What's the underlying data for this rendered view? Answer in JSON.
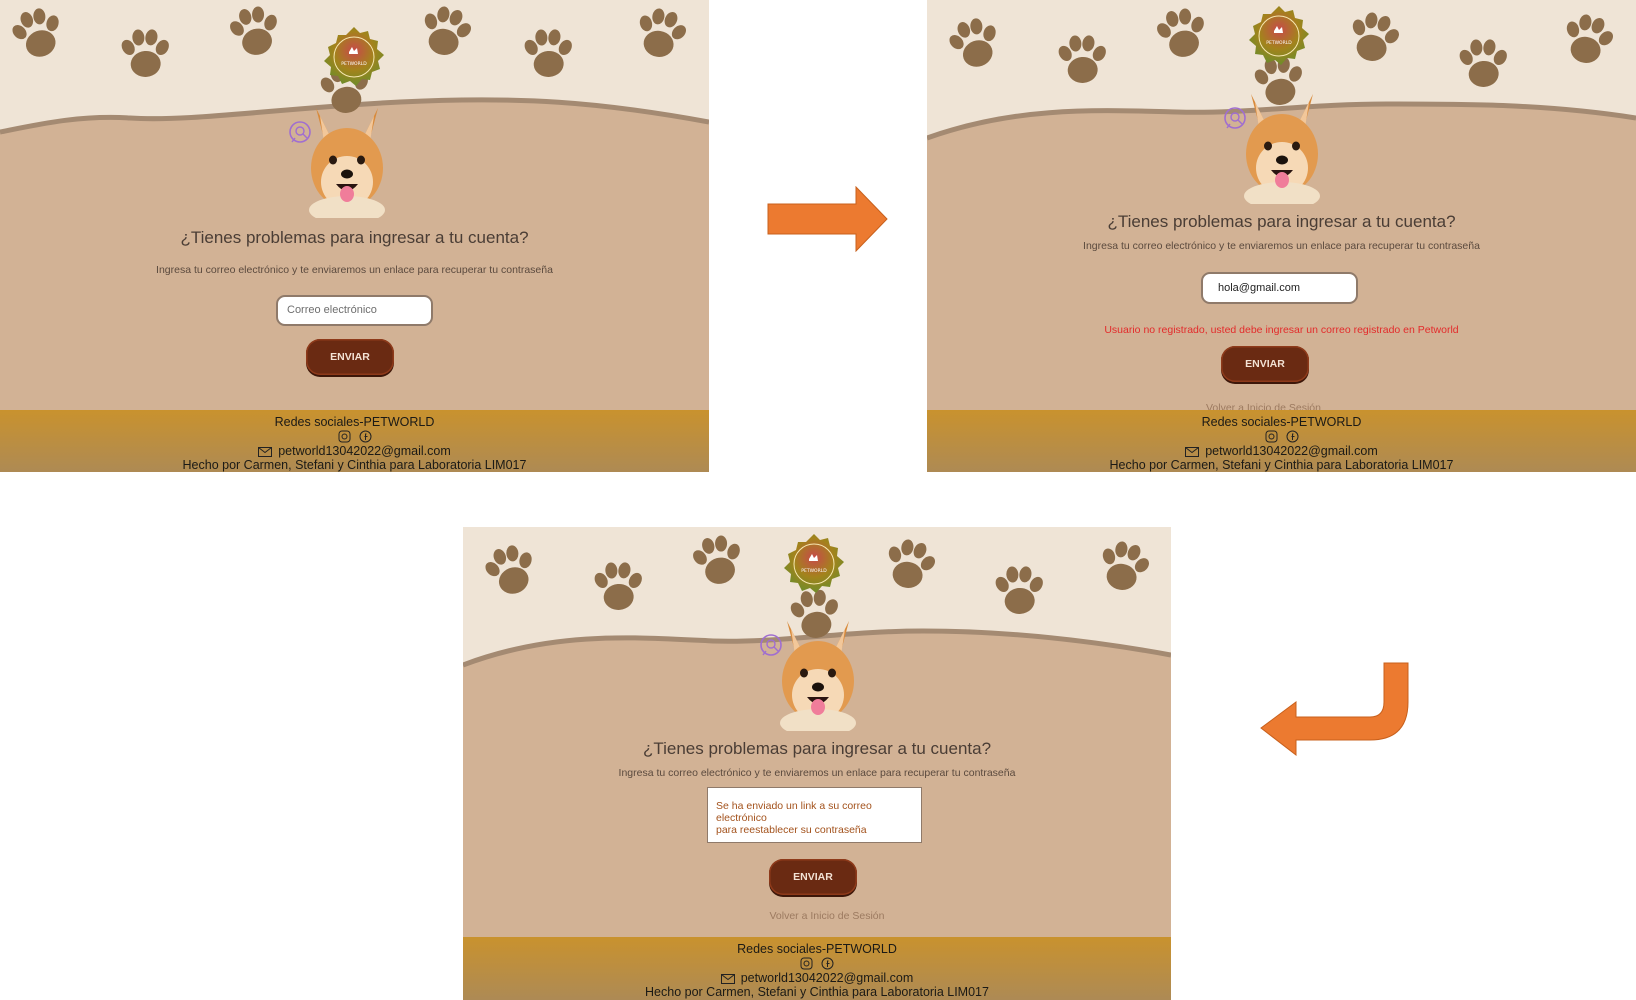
{
  "screens": {
    "s1": {
      "logo_text": "PETWORLD",
      "title": "¿Tienes problemas para ingresar a tu cuenta?",
      "subtitle": "Ingresa tu correo electrónico y te enviaremos un enlace para recuperar tu contraseña",
      "email_placeholder": "Correo electrónico",
      "send_label": "ENVIAR"
    },
    "s2": {
      "logo_text": "PETWORLD",
      "title": "¿Tienes problemas para ingresar a tu cuenta?",
      "subtitle": "Ingresa tu correo electrónico y te enviaremos un enlace para recuperar tu contraseña",
      "email_value": "hola@gmail.com",
      "error": "Usuario no registrado, usted debe ingresar un correo registrado en Petworld",
      "send_label": "ENVIAR",
      "back_link": "Volver a Inicio de Sesión"
    },
    "s3": {
      "logo_text": "PETWORLD",
      "title": "¿Tienes problemas para ingresar a tu cuenta?",
      "subtitle": "Ingresa tu correo electrónico y te enviaremos un enlace para recuperar tu contraseña",
      "message_line1": "Se ha enviado un link a su correo electrónico",
      "message_line2": "para reestablecer su contraseña",
      "send_label": "ENVIAR",
      "back_link": "Volver a Inicio de Sesión"
    }
  },
  "footer": {
    "social": "Redes sociales-PETWORLD",
    "email": "petworld13042022@gmail.com",
    "credits": "Hecho por Carmen, Stefani y Cinthia para Laboratoria LIM017"
  },
  "colors": {
    "background_cream": "#efe4d6",
    "background_tan": "#d2b295",
    "paw": "#8c6d4a",
    "button": "#6a2a12",
    "error": "#e32b2b",
    "footer_gold": "#c9922e",
    "arrow": "#ec7a30"
  },
  "icons": [
    "paw-print-icon",
    "petworld-logo-icon",
    "dog-image",
    "search-icon",
    "instagram-icon",
    "facebook-icon",
    "mail-icon",
    "arrow-right-icon",
    "arrow-down-left-icon"
  ]
}
